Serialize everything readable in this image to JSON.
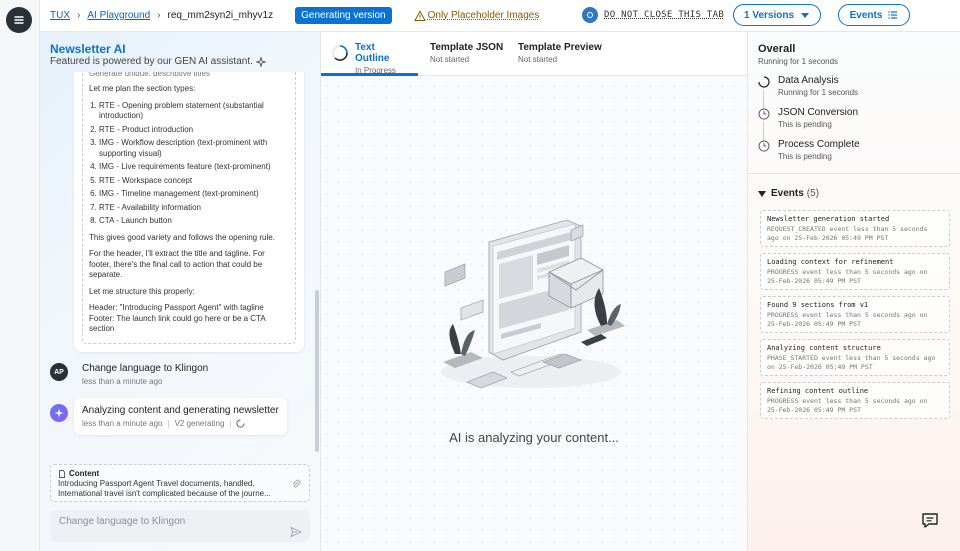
{
  "topbar": {
    "breadcrumb": [
      "TUX",
      "AI Playground",
      "req_mm2syn2i_mhyv1z"
    ],
    "generating_badge": "Generating version",
    "warning": "Only Placeholder Images",
    "do_not_close": "DO NOT CLOSE THIS TAB",
    "versions_button": "1 Versions",
    "events_button": "Events"
  },
  "left_panel": {
    "title": "Newsletter AI",
    "subtitle": "Featured is powered by our GEN AI assistant.",
    "reasoning": {
      "cut_line": "Generate unique, descriptive titles",
      "intro": "Let me plan the section types:",
      "items": [
        "RTE - Opening problem statement (substantial introduction)",
        "RTE - Product introduction",
        "IMG - Workflow description (text-prominent with supporting visual)",
        "IMG - Live requirements feature (text-prominent)",
        "RTE - Workspace concept",
        "IMG - Timeline management (text-prominent)",
        "RTE - Availability information",
        "CTA - Launch button"
      ],
      "p1": "This gives good variety and follows the opening rule.",
      "p2": "For the header, I'll extract the title and tagline. For footer, there's the final call to action that could be separate.",
      "p3": "Let me structure this properly:",
      "p4": "Header: \"Introducing Passport Agent\" with tagline Footer: The launch link could go here or be a CTA section"
    },
    "messages": [
      {
        "avatar": "AP",
        "title": "Change language to Klingon",
        "time": "less than a minute ago"
      },
      {
        "title": "Analyzing content and generating newsletter",
        "time": "less than a minute ago",
        "version": "V2 generating"
      }
    ],
    "content_card": {
      "label": "Content",
      "line1": "Introducing Passport Agent Travel documents, handled.",
      "line2": "International travel isn't complicated because of the journe..."
    },
    "input_placeholder": "Change language to Klingon"
  },
  "center": {
    "tabs": [
      {
        "label": "Text Outline",
        "status": "In Progress"
      },
      {
        "label": "Template JSON",
        "status": "Not started"
      },
      {
        "label": "Template Preview",
        "status": "Not started"
      }
    ],
    "status_text": "AI is analyzing your content..."
  },
  "right_panel": {
    "overall_title": "Overall",
    "overall_sub": "Running for 1 seconds",
    "steps": [
      {
        "title": "Data Analysis",
        "sub": "Running for 1 seconds"
      },
      {
        "title": "JSON Conversion",
        "sub": "This is pending"
      },
      {
        "title": "Process Complete",
        "sub": "This is pending"
      }
    ],
    "events_label": "Events",
    "events_count": "(5)",
    "events": [
      {
        "title": "Newsletter generation started",
        "sub": "REQUEST_CREATED event less than 5 seconds ago on 25-Feb-2026 05:49 PM PST"
      },
      {
        "title": "Loading context for refinement",
        "sub": "PROGRESS event less than 5 seconds ago on 25-Feb-2026 05:49 PM PST"
      },
      {
        "title": "Found 9 sections from v1",
        "sub": "PROGRESS event less than 5 seconds ago on 25-Feb-2026 05:49 PM PST"
      },
      {
        "title": "Analyzing content structure",
        "sub": "PHASE_STARTED event less than 5 seconds ago on 25-Feb-2026 05:49 PM PST"
      },
      {
        "title": "Refining content outline",
        "sub": "PROGRESS event less than 5 seconds ago on 25-Feb-2026 05:49 PM PST"
      }
    ]
  },
  "colors": {
    "accent": "#0972d3",
    "warning": "#8a5a00",
    "dark": "#2b2f36"
  },
  "icons": [
    "menu-icon",
    "warning-icon",
    "chevron-down-icon",
    "list-icon",
    "sparkle-icon",
    "document-icon",
    "paperclip-icon",
    "send-icon",
    "spinner-icon",
    "clock-icon",
    "feedback-icon"
  ]
}
